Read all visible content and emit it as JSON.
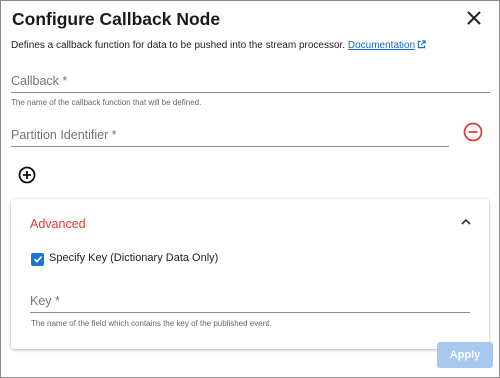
{
  "dialog": {
    "title": "Configure Callback Node",
    "description": "Defines a callback function for data to be pushed into the stream processor.",
    "doc_link_label": "Documentation",
    "close_icon": "close-icon"
  },
  "fields": {
    "callback": {
      "label": "Callback *",
      "value": "",
      "helper": "The name of the callback function that will be defined."
    },
    "partition": {
      "label": "Partition Identifier *",
      "value": ""
    }
  },
  "icons": {
    "remove": "minus-circle-icon",
    "add": "plus-circle-icon"
  },
  "advanced": {
    "title": "Advanced",
    "specify_key": {
      "label": "Specify Key (Dictionary Data Only)",
      "checked": true
    },
    "key_field": {
      "label": "Key *",
      "value": "",
      "helper": "The name of the field which contains the key of the published event."
    }
  },
  "actions": {
    "apply_label": "Apply"
  },
  "colors": {
    "accent_blue": "#1976d2",
    "error_red": "#e53935",
    "apply_disabled": "#a8c8f0"
  }
}
